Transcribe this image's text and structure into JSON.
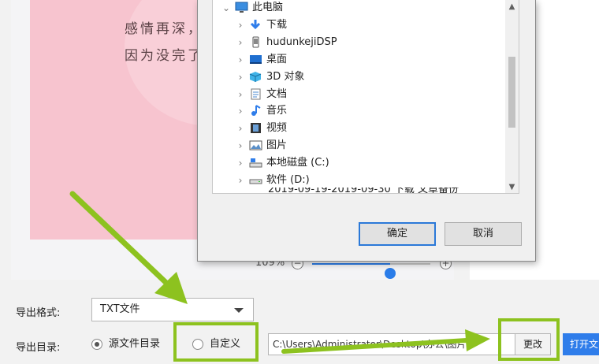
{
  "preview": {
    "poem_line_1": "感情再深，",
    "poem_line_2": "因为没完了"
  },
  "zoom": {
    "value": "109%",
    "out_symbol": "−",
    "in_symbol": "+",
    "level_fraction": 0.66
  },
  "export": {
    "format_label": "导出格式:",
    "format_value": "TXT文件",
    "dir_label": "导出目录:",
    "radio_source": "源文件目录",
    "radio_custom": "自定义",
    "path_value": "C:\\Users\\Administrator\\Desktop\\办公\\图片",
    "change_label": "更改",
    "open_label": "打开文"
  },
  "dialog": {
    "tree_items": [
      {
        "label": "此电脑",
        "icon": "computer-icon",
        "level": 0
      },
      {
        "label": "下载",
        "icon": "download-icon",
        "level": 1
      },
      {
        "label": "hudunkejiDSP",
        "icon": "phone-icon",
        "level": 1
      },
      {
        "label": "桌面",
        "icon": "desktop-icon",
        "level": 1
      },
      {
        "label": "3D 对象",
        "icon": "cube-icon",
        "level": 1
      },
      {
        "label": "文档",
        "icon": "document-icon",
        "level": 1
      },
      {
        "label": "音乐",
        "icon": "music-icon",
        "level": 1
      },
      {
        "label": "视频",
        "icon": "video-icon",
        "level": 1
      },
      {
        "label": "图片",
        "icon": "picture-icon",
        "level": 1
      },
      {
        "label": "本地磁盘 (C:)",
        "icon": "drive-c-icon",
        "level": 1
      },
      {
        "label": "软件 (D:)",
        "icon": "drive-d-icon",
        "level": 1
      }
    ],
    "partial_item": "2019-09-19-2019-09-30 下载 文章备份",
    "ok_label": "确定",
    "cancel_label": "取消"
  },
  "colors": {
    "accent": "#2f7dea",
    "annotation": "#8dc21f",
    "preview_page": "#f7c4cf"
  }
}
